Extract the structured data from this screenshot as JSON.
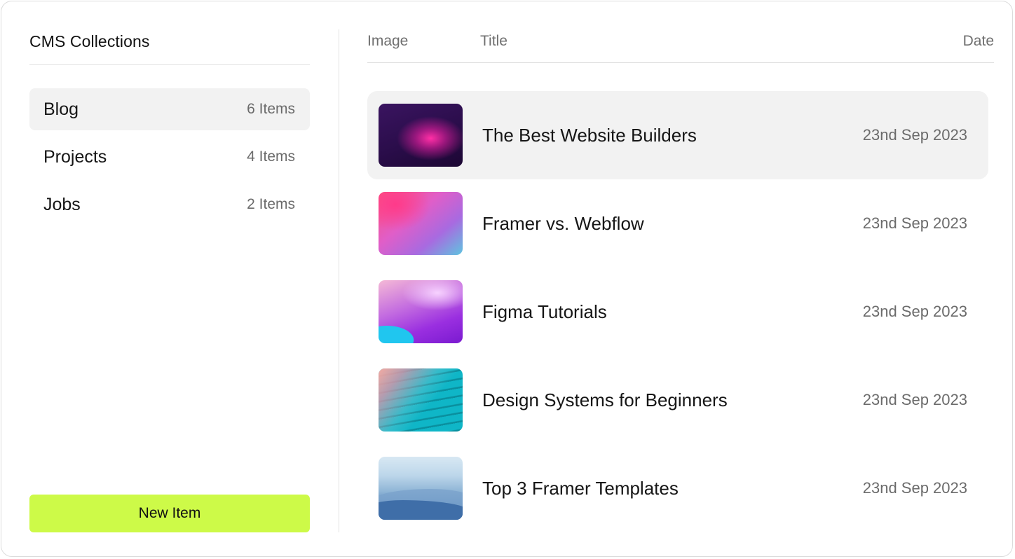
{
  "sidebar": {
    "title": "CMS Collections",
    "items": [
      {
        "label": "Blog",
        "count": "6 Items"
      },
      {
        "label": "Projects",
        "count": "4 Items"
      },
      {
        "label": "Jobs",
        "count": "2 Items"
      }
    ],
    "new_item_label": "New Item"
  },
  "table": {
    "columns": {
      "image": "Image",
      "title": "Title",
      "date": "Date"
    },
    "rows": [
      {
        "title": "The Best Website Builders",
        "date": "23nd Sep 2023",
        "thumbnail": "abstract-purple-pink-image"
      },
      {
        "title": "Framer vs. Webflow",
        "date": "23nd Sep 2023",
        "thumbnail": "pink-gradient-image"
      },
      {
        "title": "Figma Tutorials",
        "date": "23nd Sep 2023",
        "thumbnail": "purple-cyan-wave-image"
      },
      {
        "title": "Design Systems for Beginners",
        "date": "23nd Sep 2023",
        "thumbnail": "teal-layered-steps-image"
      },
      {
        "title": "Top 3 Framer Templates",
        "date": "23nd Sep 2023",
        "thumbnail": "blue-mountains-image"
      }
    ]
  },
  "colors": {
    "accent": "#cdfa48",
    "selected_bg": "#f2f2f2"
  }
}
